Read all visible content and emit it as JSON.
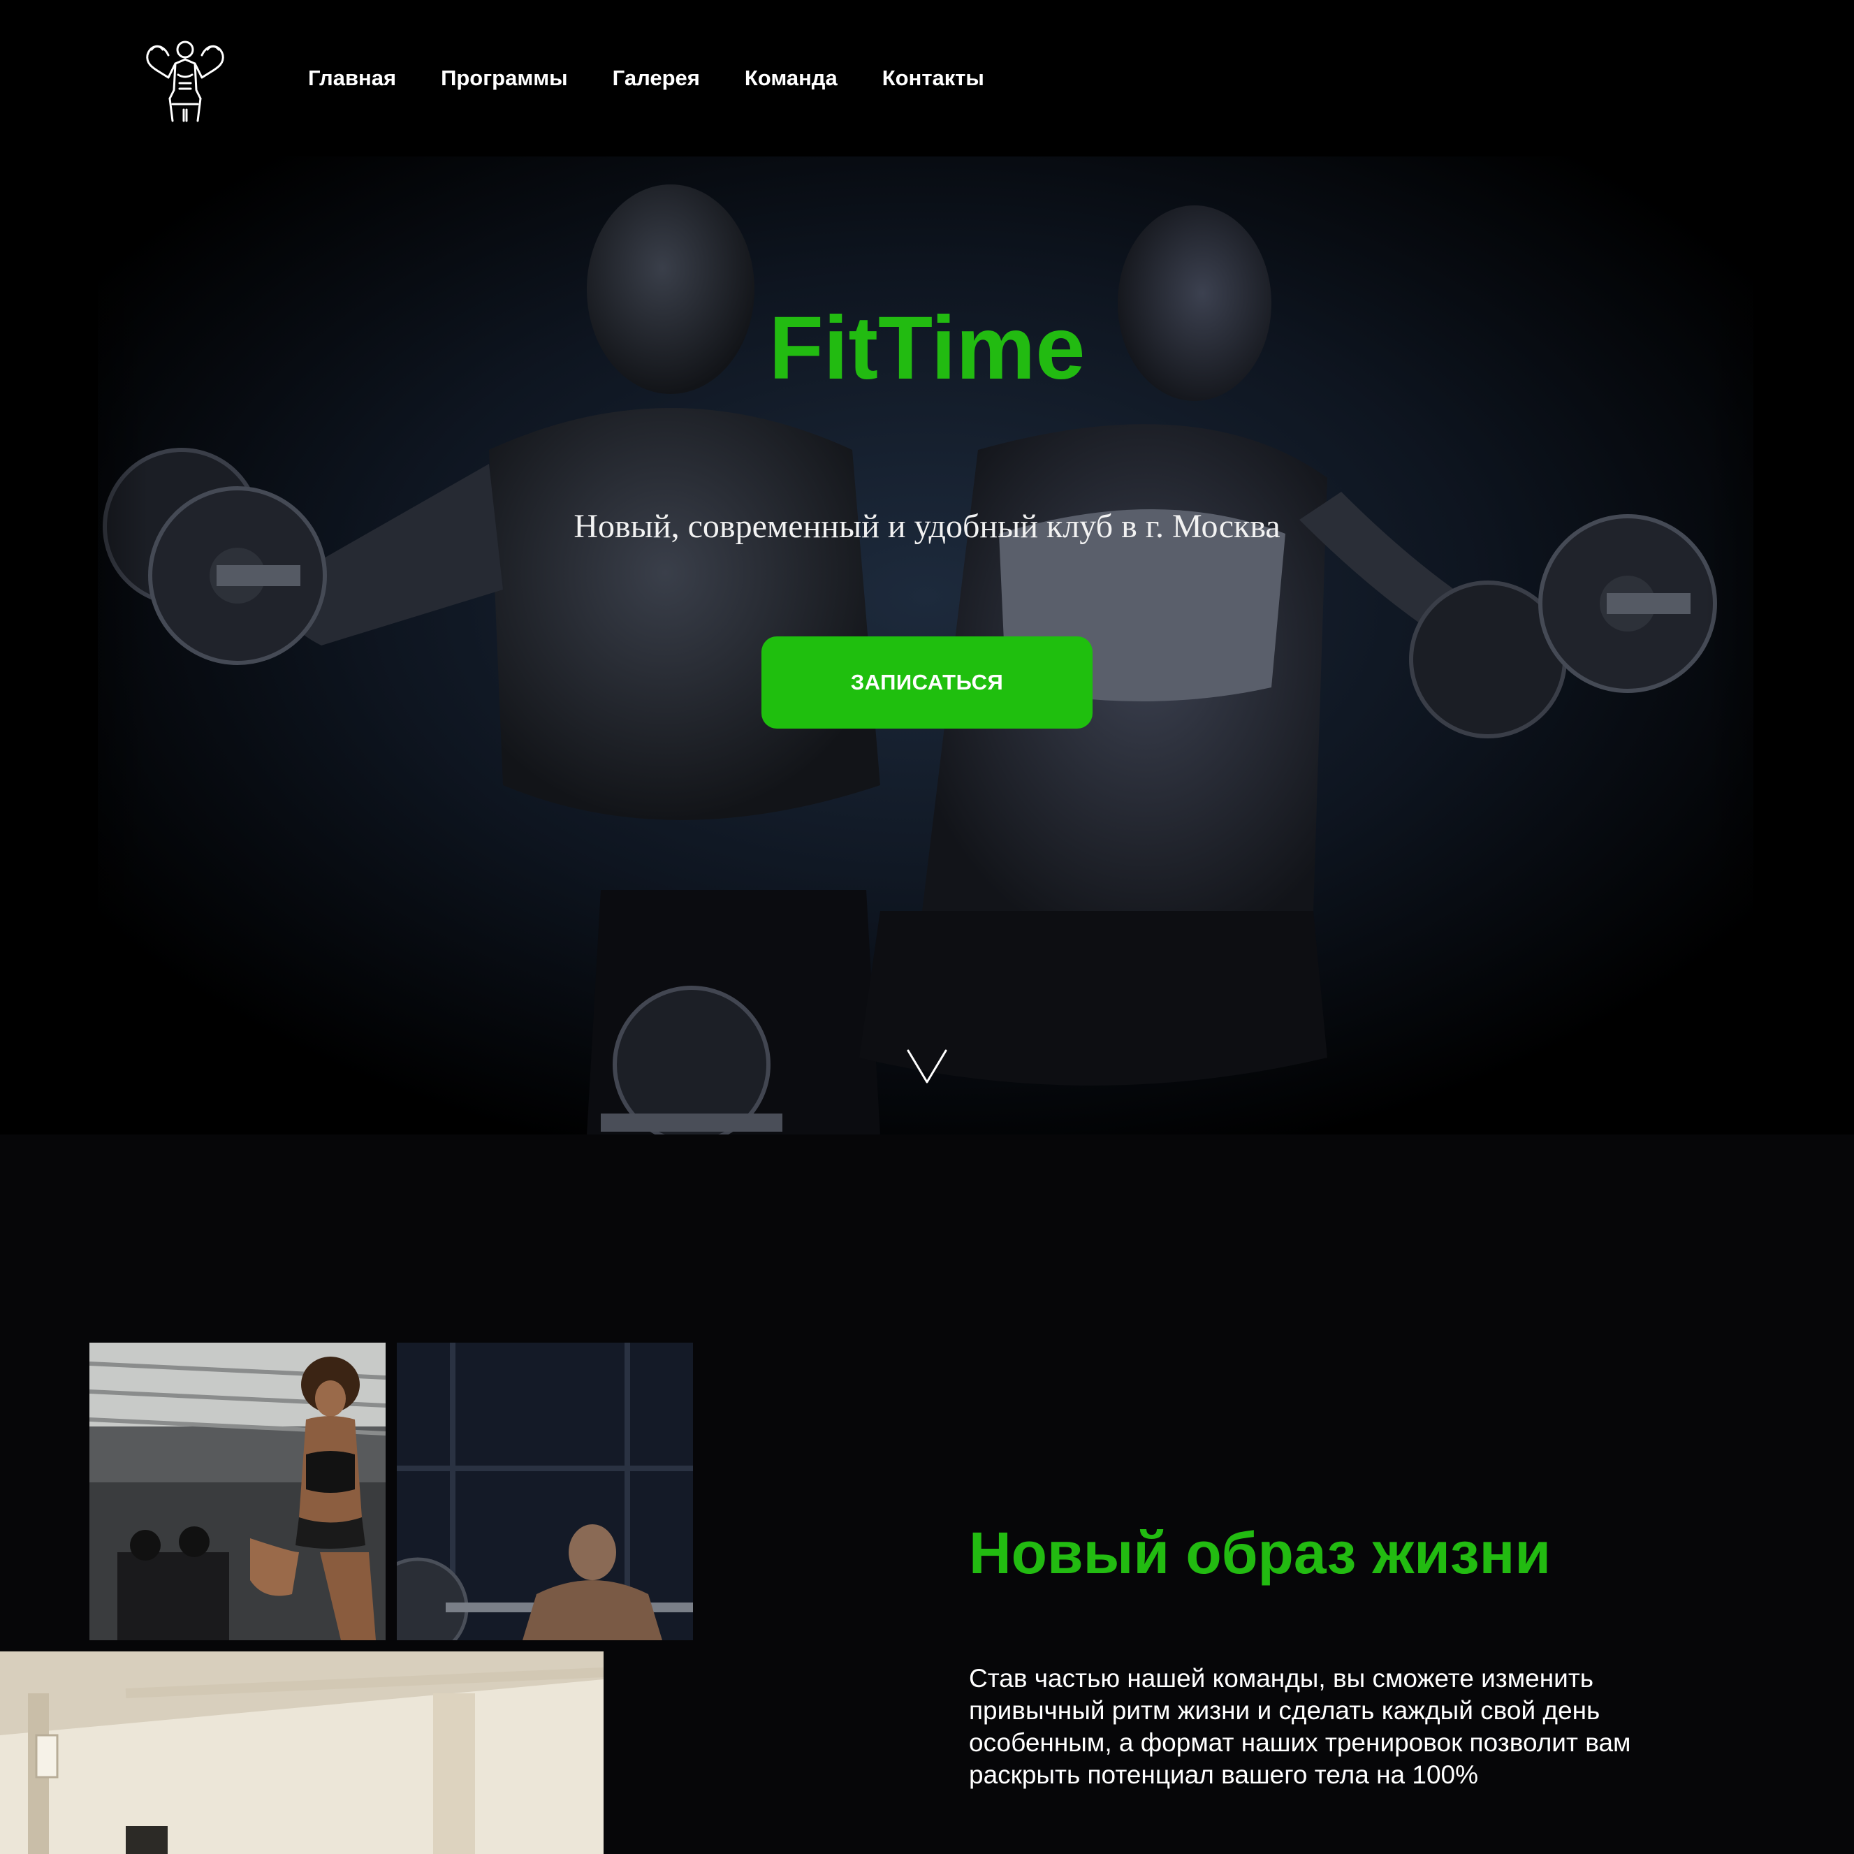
{
  "header": {
    "logo_icon": "bodybuilder-icon",
    "nav": [
      {
        "label": "Главная"
      },
      {
        "label": "Программы"
      },
      {
        "label": "Галерея"
      },
      {
        "label": "Команда"
      },
      {
        "label": "Контакты"
      }
    ]
  },
  "hero": {
    "title": "FitTime",
    "subtitle": "Новый, современный и удобный клуб в г. Москва",
    "cta_label": "ЗАПИСАТЬСЯ",
    "scroll_icon": "chevron-down-icon"
  },
  "about": {
    "title": "Новый образ жизни",
    "text": "Став частью нашей команды, вы сможете изменить привычный ритм жизни и сделать каждый свой день особенным, а формат наших тренировок позволит вам раскрыть потенциал вашего тела на 100%"
  },
  "colors": {
    "accent": "#1fbf0e",
    "background": "#000000",
    "text": "#ffffff"
  }
}
